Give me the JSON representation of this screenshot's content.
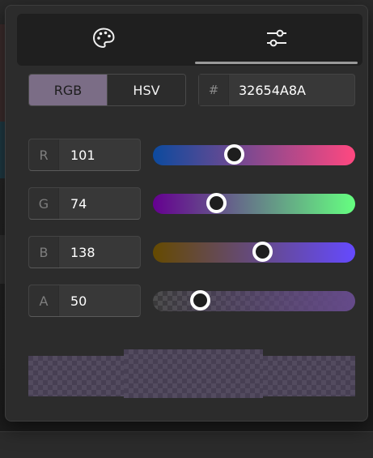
{
  "tabs": [
    {
      "icon": "palette-icon",
      "active": false
    },
    {
      "icon": "sliders-icon",
      "active": true
    }
  ],
  "mode": {
    "options": [
      "RGB",
      "HSV"
    ],
    "selected": "RGB"
  },
  "hex": {
    "prefix": "#",
    "value": "32654A8A"
  },
  "channels": [
    {
      "label": "R",
      "value": "101",
      "slider_fraction": 0.4
    },
    {
      "label": "G",
      "value": "74",
      "slider_fraction": 0.31
    },
    {
      "label": "B",
      "value": "138",
      "slider_fraction": 0.54
    },
    {
      "label": "A",
      "value": "50",
      "slider_fraction": 0.23
    }
  ],
  "colors": {
    "r_gradient": [
      "#0c4a9e",
      "#ff4880"
    ],
    "g_gradient": [
      "#650090",
      "#65ff80"
    ],
    "b_gradient": [
      "#654a00",
      "#654aff"
    ],
    "current": "#654A8A",
    "selected_segment": "#7b6d86"
  }
}
